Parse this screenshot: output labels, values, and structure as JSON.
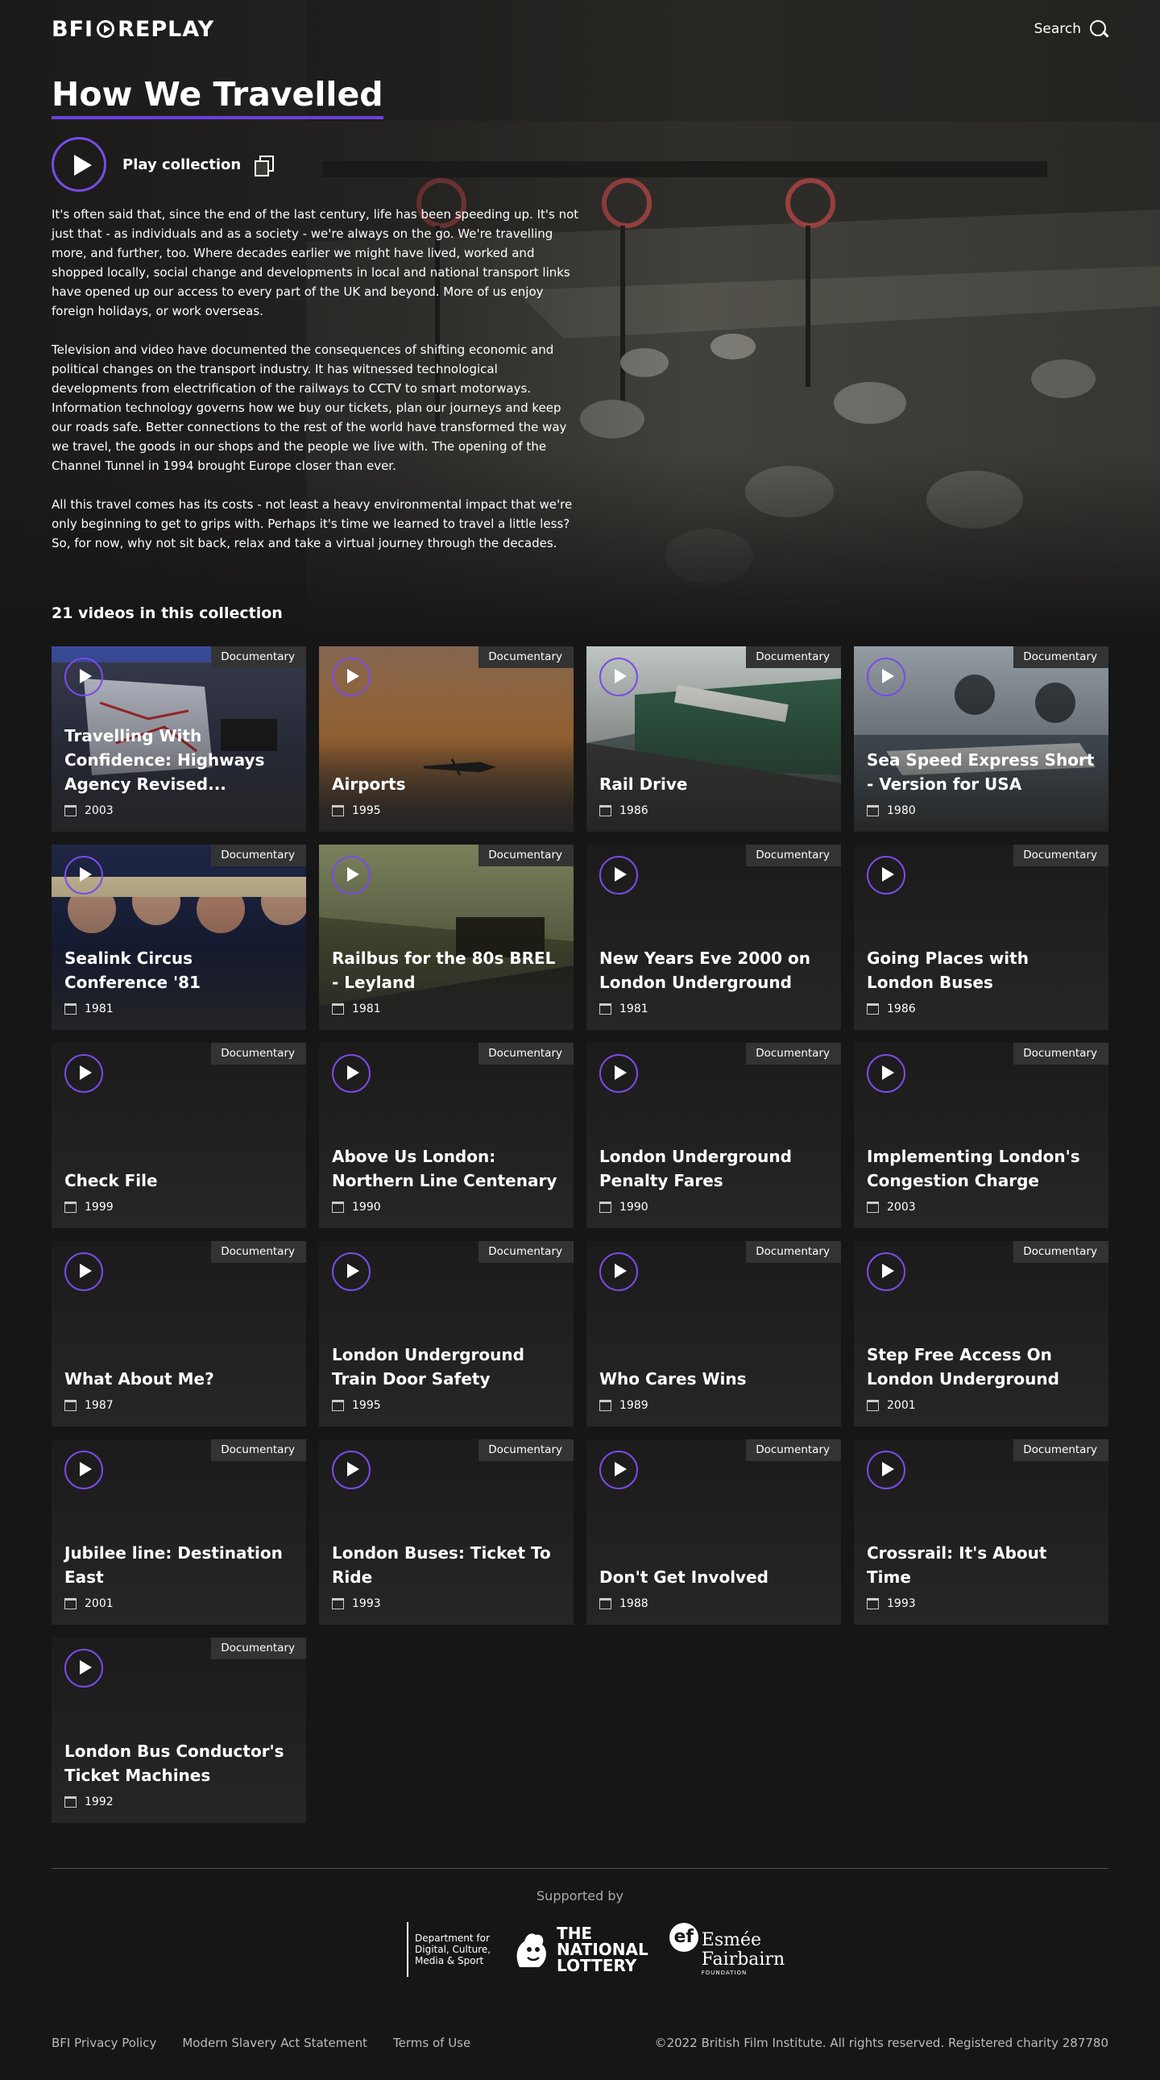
{
  "header": {
    "logo": "BFI REPLAY",
    "logo_left": "BFI",
    "logo_right": "REPLAY",
    "search_label": "Search"
  },
  "collection": {
    "title": "How We Travelled",
    "play_label": "Play collection",
    "description": [
      "It's often said that, since the end of the last century, life has been speeding up. It's not just that - as individuals and as a society - we're always on the go. We're travelling more, and further, too. Where decades earlier we might have lived, worked and shopped locally, social change and developments in local and national transport links have opened up our access to every part of the UK and beyond. More of us enjoy foreign holidays, or work overseas.",
      "Television and video have documented the consequences of shifting economic and political changes on the transport industry. It has witnessed technological developments from electrification of the railways to CCTV to smart motorways. Information technology governs how we buy our tickets, plan our journeys and keep our roads safe. Better connections to the rest of the world have transformed the way we travel, the goods in our shops and the people we live with. The opening of the Channel Tunnel in 1994 brought Europe closer than ever.",
      "All this travel comes has its costs - not least a heavy environmental impact that we're only beginning to get to grips with. Perhaps it's time we learned to travel a little less? So, for now, why not sit back, relax and take a virtual journey through the decades."
    ],
    "count_label": "21 videos in this collection"
  },
  "videos": [
    {
      "title": "Travelling With Confidence: Highways Agency Revised...",
      "year": "2003",
      "tag": "Documentary",
      "thumb": "screen"
    },
    {
      "title": "Airports",
      "year": "1995",
      "tag": "Documentary",
      "thumb": "sunset"
    },
    {
      "title": "Rail Drive",
      "year": "1986",
      "tag": "Documentary",
      "thumb": "train"
    },
    {
      "title": "Sea Speed Express Short - Version for USA",
      "year": "1980",
      "tag": "Documentary",
      "thumb": "sea"
    },
    {
      "title": "Sealink Circus Conference '81",
      "year": "1981",
      "tag": "Documentary",
      "thumb": "crowd"
    },
    {
      "title": "Railbus for the 80s BREL - Leyland",
      "year": "1981",
      "tag": "Documentary",
      "thumb": "railbus"
    },
    {
      "title": "New Years Eve 2000 on London Underground",
      "year": "1981",
      "tag": "Documentary",
      "thumb": ""
    },
    {
      "title": "Going Places with London Buses",
      "year": "1986",
      "tag": "Documentary",
      "thumb": ""
    },
    {
      "title": "Check File",
      "year": "1999",
      "tag": "Documentary",
      "thumb": ""
    },
    {
      "title": "Above Us London: Northern Line Centenary",
      "year": "1990",
      "tag": "Documentary",
      "thumb": ""
    },
    {
      "title": "London Underground Penalty Fares",
      "year": "1990",
      "tag": "Documentary",
      "thumb": ""
    },
    {
      "title": "Implementing London's Congestion Charge",
      "year": "2003",
      "tag": "Documentary",
      "thumb": ""
    },
    {
      "title": "What About Me?",
      "year": "1987",
      "tag": "Documentary",
      "thumb": ""
    },
    {
      "title": "London Underground Train Door Safety",
      "year": "1995",
      "tag": "Documentary",
      "thumb": ""
    },
    {
      "title": "Who Cares Wins",
      "year": "1989",
      "tag": "Documentary",
      "thumb": ""
    },
    {
      "title": "Step Free Access On London Underground",
      "year": "2001",
      "tag": "Documentary",
      "thumb": ""
    },
    {
      "title": "Jubilee line: Destination East",
      "year": "2001",
      "tag": "Documentary",
      "thumb": ""
    },
    {
      "title": "London Buses: Ticket To Ride",
      "year": "1993",
      "tag": "Documentary",
      "thumb": ""
    },
    {
      "title": "Don't Get Involved",
      "year": "1988",
      "tag": "Documentary",
      "thumb": ""
    },
    {
      "title": "Crossrail: It's About Time",
      "year": "1993",
      "tag": "Documentary",
      "thumb": ""
    },
    {
      "title": "London Bus Conductor's Ticket Machines",
      "year": "1992",
      "tag": "Documentary",
      "thumb": ""
    }
  ],
  "footer": {
    "supported_by": "Supported by",
    "dcms": [
      "Department for",
      "Digital, Culture,",
      "Media & Sport"
    ],
    "lottery": [
      "THE",
      "NATIONAL",
      "LOTTERY"
    ],
    "esmee_mark": "ef",
    "esmee": [
      "Esmée",
      "Fairbairn"
    ],
    "esmee_sub": "FOUNDATION",
    "links": [
      "BFI Privacy Policy",
      "Modern Slavery Act Statement",
      "Terms of Use"
    ],
    "copyright": "©2022 British Film Institute. All rights reserved. Registered charity 287780"
  },
  "colors": {
    "accent": "#6b3fe0",
    "background": "#161616",
    "card": "#232323",
    "badge": "#333333"
  },
  "icons": {
    "search": "search-icon",
    "play": "play-icon",
    "copy": "copy-link-icon",
    "calendar": "calendar-icon"
  }
}
